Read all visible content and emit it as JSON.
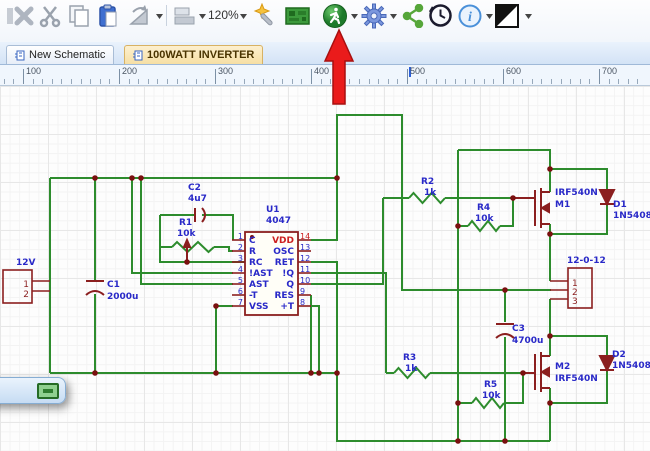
{
  "toolbar": {
    "zoom_level": "120%",
    "icons": [
      "delete-icon",
      "cut-icon",
      "copy-icon",
      "paste-icon",
      "rotate-icon",
      "align-icon",
      "zoom-select",
      "wizard-icon",
      "pcb-icon",
      "run-simulation-icon",
      "settings-gear-icon",
      "share-icon",
      "history-icon",
      "info-icon",
      "theme-contrast-icon"
    ]
  },
  "tabs": [
    {
      "label": "New Schematic",
      "active": false
    },
    {
      "label": "100WATT INVERTER",
      "active": true
    }
  ],
  "ruler": {
    "labels": [
      "100",
      "200",
      "300",
      "400",
      "500",
      "600",
      "700"
    ]
  },
  "schematic": {
    "source": {
      "label": "12V",
      "pins": [
        "1",
        "2"
      ]
    },
    "transformer": {
      "label": "12-0-12",
      "pins": [
        "1",
        "2",
        "3"
      ]
    },
    "components": {
      "c1": {
        "ref": "C1",
        "value": "2000u"
      },
      "c2": {
        "ref": "C2",
        "value": "4u7"
      },
      "c3": {
        "ref": "C3",
        "value": "4700u"
      },
      "r1": {
        "ref": "R1",
        "value": "10k"
      },
      "r2": {
        "ref": "R2",
        "value": "1k"
      },
      "r3": {
        "ref": "R3",
        "value": "1k"
      },
      "r4": {
        "ref": "R4",
        "value": "10k"
      },
      "r5": {
        "ref": "R5",
        "value": "10k"
      },
      "u1": {
        "ref": "U1",
        "value": "4047"
      },
      "m1": {
        "ref": "M1",
        "part": "IRF540N"
      },
      "m2": {
        "ref": "M2",
        "part": "IRF540N"
      },
      "d1": {
        "ref": "D1",
        "part": "1N5408"
      },
      "d2": {
        "ref": "D2",
        "part": "1N5408"
      }
    },
    "ic": {
      "pins_left": [
        {
          "num": "1",
          "name": "C"
        },
        {
          "num": "2",
          "name": "R"
        },
        {
          "num": "3",
          "name": "RC"
        },
        {
          "num": "4",
          "name": "!AST"
        },
        {
          "num": "5",
          "name": "AST"
        },
        {
          "num": "6",
          "name": "-T"
        },
        {
          "num": "7",
          "name": "VSS"
        }
      ],
      "pins_right": [
        {
          "num": "14",
          "name": "VDD"
        },
        {
          "num": "13",
          "name": "OSC"
        },
        {
          "num": "12",
          "name": "RET"
        },
        {
          "num": "11",
          "name": "!Q"
        },
        {
          "num": "10",
          "name": "Q"
        },
        {
          "num": "9",
          "name": "RES"
        },
        {
          "num": "8",
          "name": "+T"
        }
      ]
    },
    "colors": {
      "wire": "#2d8c2d",
      "symbol": "#8b1f1f",
      "label": "#2929c8",
      "power_pin": "#cc2020",
      "junction": "#7a1010",
      "annotation_arrow": "#ea1b1b"
    }
  }
}
